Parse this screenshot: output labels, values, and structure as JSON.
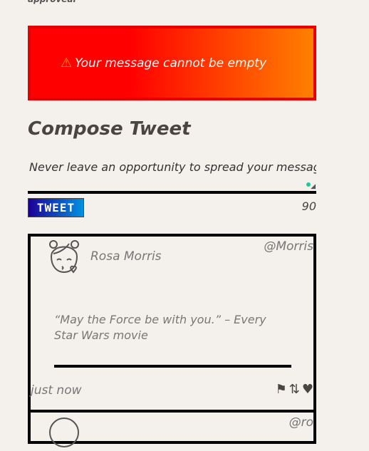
{
  "top_text": "approveal",
  "alert": {
    "icon": "warning-icon",
    "text": "Your message cannot be empty",
    "colors": {
      "border": "#e60000",
      "from": "#ff0000",
      "to": "#ff8000"
    }
  },
  "compose": {
    "title": "Compose Tweet",
    "value": "Never leave an opportunity to spread your message!",
    "button_label": "TWEET",
    "counter": "90"
  },
  "tweets": [
    {
      "name": "Rosa Morris",
      "handle": "@Morris",
      "text": "“May the Force be with you.” – Every Star Wars movie",
      "time": "just now",
      "actions": [
        "flag-icon",
        "retweet-icon",
        "heart-icon"
      ]
    },
    {
      "handle": "@ro"
    }
  ]
}
